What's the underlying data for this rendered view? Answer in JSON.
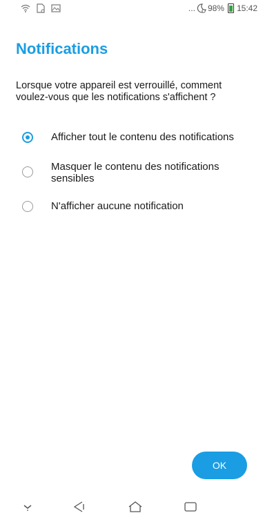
{
  "status_bar": {
    "dots": "...",
    "battery_percent": "98%",
    "time": "15:42",
    "icons": [
      "wifi-icon",
      "sim-card-icon",
      "image-notification-icon",
      "do-not-disturb-icon",
      "battery-icon"
    ]
  },
  "page": {
    "title": "Notifications",
    "question": "Lorsque votre appareil est verrouillé, comment voulez-vous que les notifications s'affichent ?"
  },
  "options": [
    {
      "label": "Afficher tout le contenu des notifications",
      "selected": true
    },
    {
      "label": "Masquer le contenu des notifications sensibles",
      "selected": false
    },
    {
      "label": "N'afficher aucune notification",
      "selected": false
    }
  ],
  "actions": {
    "ok_label": "OK"
  },
  "colors": {
    "accent": "#1a9de3",
    "battery_fill": "#3aa142"
  },
  "nav_bar": {
    "icons": [
      "chevron-down-icon",
      "back-icon",
      "home-icon",
      "recents-icon"
    ]
  }
}
